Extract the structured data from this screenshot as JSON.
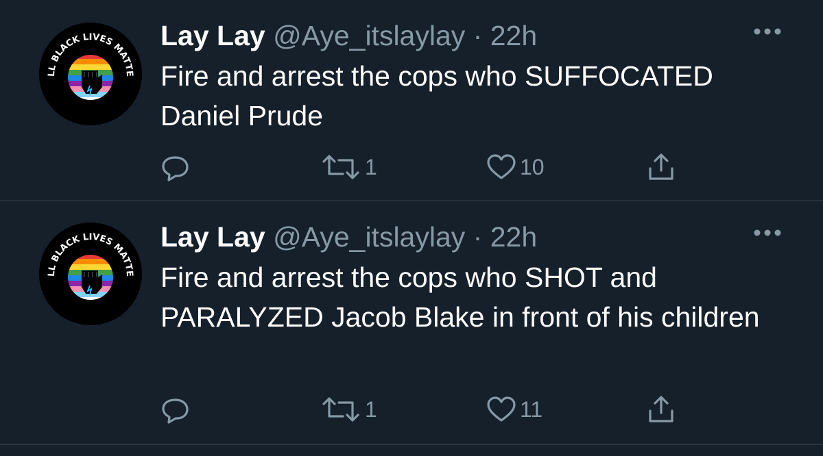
{
  "colors": {
    "background": "#15202b",
    "text_primary": "#ffffff",
    "text_secondary": "#8899a6",
    "divider": "#263340"
  },
  "tweets": [
    {
      "display_name": "Lay Lay",
      "handle": "@Aye_itslaylay",
      "separator": "·",
      "time": "22h",
      "text": "Fire and arrest the cops who SUFFOCATED Daniel Prude",
      "avatar_logo_text": "ALL BLACK LIVES MATTER",
      "retweets": "1",
      "likes": "10",
      "icons": [
        "reply-icon",
        "retweet-icon",
        "heart-icon",
        "share-icon",
        "more-icon"
      ]
    },
    {
      "display_name": "Lay Lay",
      "handle": "@Aye_itslaylay",
      "separator": "·",
      "time": "22h",
      "text": "Fire and arrest the cops who SHOT and PARALYZED Jacob Blake in front of his children",
      "avatar_logo_text": "ALL BLACK LIVES MATTER",
      "retweets": "1",
      "likes": "11",
      "icons": [
        "reply-icon",
        "retweet-icon",
        "heart-icon",
        "share-icon",
        "more-icon"
      ]
    }
  ]
}
